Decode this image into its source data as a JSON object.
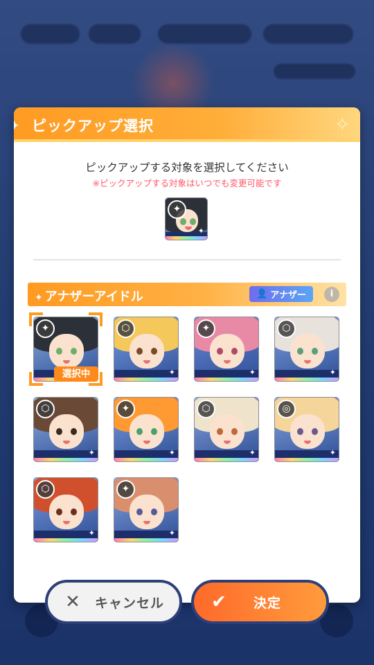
{
  "dialog": {
    "title": "ピックアップ選択",
    "intro_main": "ピックアップする対象を選択してください",
    "intro_note": "※ピックアップする対象はいつでも変更可能です"
  },
  "section": {
    "title": "アナザーアイドル",
    "badge": "アナザー",
    "info_icon": "i"
  },
  "selection": {
    "label": "選択中"
  },
  "buttons": {
    "cancel": "キャンセル",
    "ok": "決定",
    "cancel_icon": "✕",
    "ok_icon": "✔"
  },
  "cards": [
    {
      "hair": "#2c3038",
      "eye": "#6fae68",
      "bg": "#8aaee0",
      "badge": "✦",
      "selected": true
    },
    {
      "hair": "#f4c85a",
      "eye": "#7a4a2a",
      "bg": "#7aa0e6",
      "badge": "⬡",
      "selected": false
    },
    {
      "hair": "#e88aa6",
      "eye": "#b04a6a",
      "bg": "#6c8ad8",
      "badge": "✦",
      "selected": false
    },
    {
      "hair": "#e8e2dc",
      "eye": "#5aa07a",
      "bg": "#7fa3e0",
      "badge": "⬡",
      "selected": false
    },
    {
      "hair": "#6a4a36",
      "eye": "#3a2a20",
      "bg": "#8fb0e2",
      "badge": "⬡",
      "selected": false
    },
    {
      "hair": "#ff9a32",
      "eye": "#4aa06a",
      "bg": "#7ea0e0",
      "badge": "✦",
      "selected": false
    },
    {
      "hair": "#efe3cc",
      "eye": "#c0683a",
      "bg": "#8aa6e0",
      "badge": "⬡",
      "selected": false
    },
    {
      "hair": "#f5d59a",
      "eye": "#6a5a8a",
      "bg": "#8aa8e4",
      "badge": "◎",
      "selected": false
    },
    {
      "hair": "#d0502e",
      "eye": "#6a3020",
      "bg": "#7c9be0",
      "badge": "⬡",
      "selected": false
    },
    {
      "hair": "#d98e6e",
      "eye": "#5a5a9a",
      "bg": "#86a6e2",
      "badge": "✦",
      "selected": false
    }
  ],
  "picked": {
    "hair": "#2c3038",
    "eye": "#6fae68",
    "bg": "#8aaee0",
    "badge": "✦"
  }
}
